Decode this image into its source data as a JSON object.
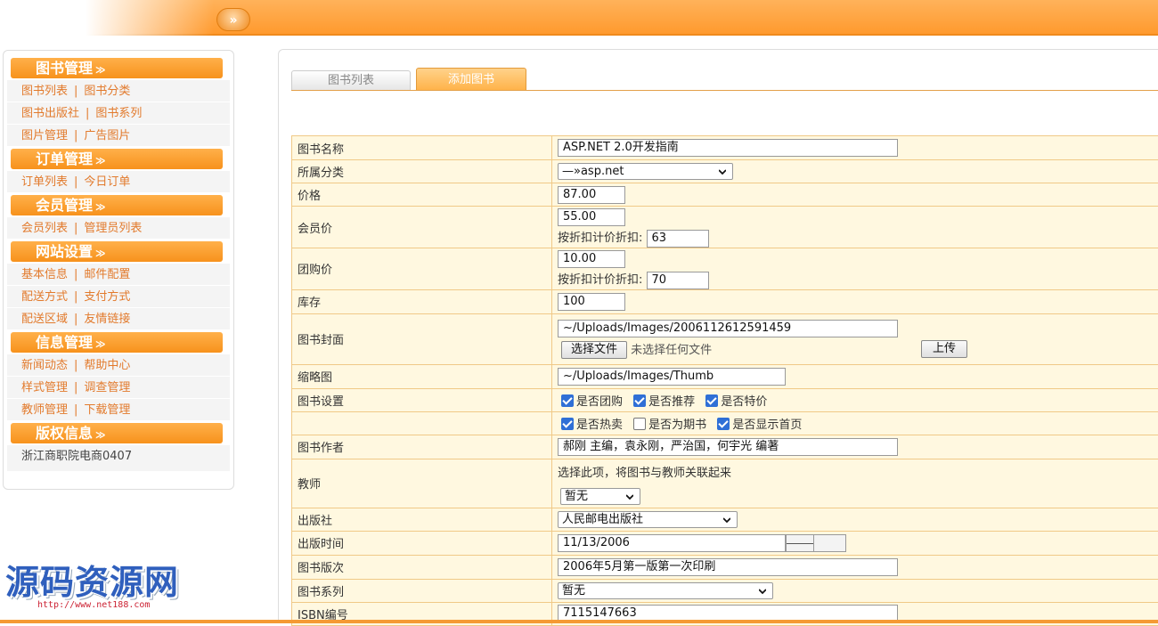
{
  "sidebar": {
    "groups": [
      {
        "title": "图书管理",
        "rows": [
          [
            "图书列表",
            "图书分类"
          ],
          [
            "图书出版社",
            "图书系列"
          ],
          [
            "图片管理",
            "广告图片"
          ]
        ]
      },
      {
        "title": "订单管理",
        "rows": [
          [
            "订单列表",
            "今日订单"
          ]
        ]
      },
      {
        "title": "会员管理",
        "rows": [
          [
            "会员列表",
            "管理员列表"
          ]
        ]
      },
      {
        "title": "网站设置",
        "rows": [
          [
            "基本信息",
            "邮件配置"
          ],
          [
            "配送方式",
            "支付方式"
          ],
          [
            "配送区域",
            "友情链接"
          ]
        ]
      },
      {
        "title": "信息管理",
        "rows": [
          [
            "新闻动态",
            "帮助中心"
          ],
          [
            "样式管理",
            "调查管理"
          ],
          [
            "教师管理",
            "下载管理"
          ]
        ]
      },
      {
        "title": "版权信息",
        "footer": "浙江商职院电商0407"
      }
    ]
  },
  "tabs": [
    {
      "label": "图书列表"
    },
    {
      "label": "添加图书"
    }
  ],
  "form": {
    "name": {
      "label": "图书名称",
      "value": "ASP.NET 2.0开发指南"
    },
    "category": {
      "label": "所属分类",
      "value": "—»asp.net"
    },
    "price": {
      "label": "价格",
      "value": "87.00"
    },
    "member_price": {
      "label": "会员价",
      "value": "55.00",
      "discount_label": "按折扣计价折扣:",
      "discount": "63"
    },
    "group_price": {
      "label": "团购价",
      "value": "10.00",
      "discount_label": "按折扣计价折扣:",
      "discount": "70"
    },
    "stock": {
      "label": "库存",
      "value": "100"
    },
    "cover": {
      "label": "图书封面",
      "value": "~/Uploads/Images/2006112612591459",
      "choose_label": "选择文件",
      "no_file": "未选择任何文件",
      "upload_label": "上传"
    },
    "thumb": {
      "label": "缩略图",
      "value": "~/Uploads/Images/Thumb"
    },
    "settings": {
      "label": "图书设置",
      "row1": [
        {
          "label": "是否团购",
          "checked": true
        },
        {
          "label": "是否推荐",
          "checked": true
        },
        {
          "label": "是否特价",
          "checked": true
        }
      ],
      "row2": [
        {
          "label": "是否热卖",
          "checked": true
        },
        {
          "label": "是否为期书",
          "checked": false
        },
        {
          "label": "是否显示首页",
          "checked": true
        }
      ]
    },
    "author": {
      "label": "图书作者",
      "value": "郝刚 主编，袁永刚，严治国，何宇光 编著"
    },
    "teacher": {
      "label": "教师",
      "hint": "选择此项，将图书与教师关联起来",
      "value": "暂无"
    },
    "publisher": {
      "label": "出版社",
      "value": "人民邮电出版社"
    },
    "pub_date": {
      "label": "出版时间",
      "value": "11/13/2006"
    },
    "edition": {
      "label": "图书版次",
      "value": "2006年5月第一版第一次印刷"
    },
    "series": {
      "label": "图书系列",
      "value": "暂无"
    },
    "isbn": {
      "label": "ISBN编号",
      "value": "7115147663"
    }
  },
  "watermark": {
    "text": "源码资源网",
    "url": "http://www.net188.com"
  },
  "colors": {
    "accent": "#f7921c",
    "menu_link": "#e27a2c",
    "form_bg": "#fff8e0",
    "form_border": "#f0c987",
    "checkbox": "#2f6fd6"
  }
}
